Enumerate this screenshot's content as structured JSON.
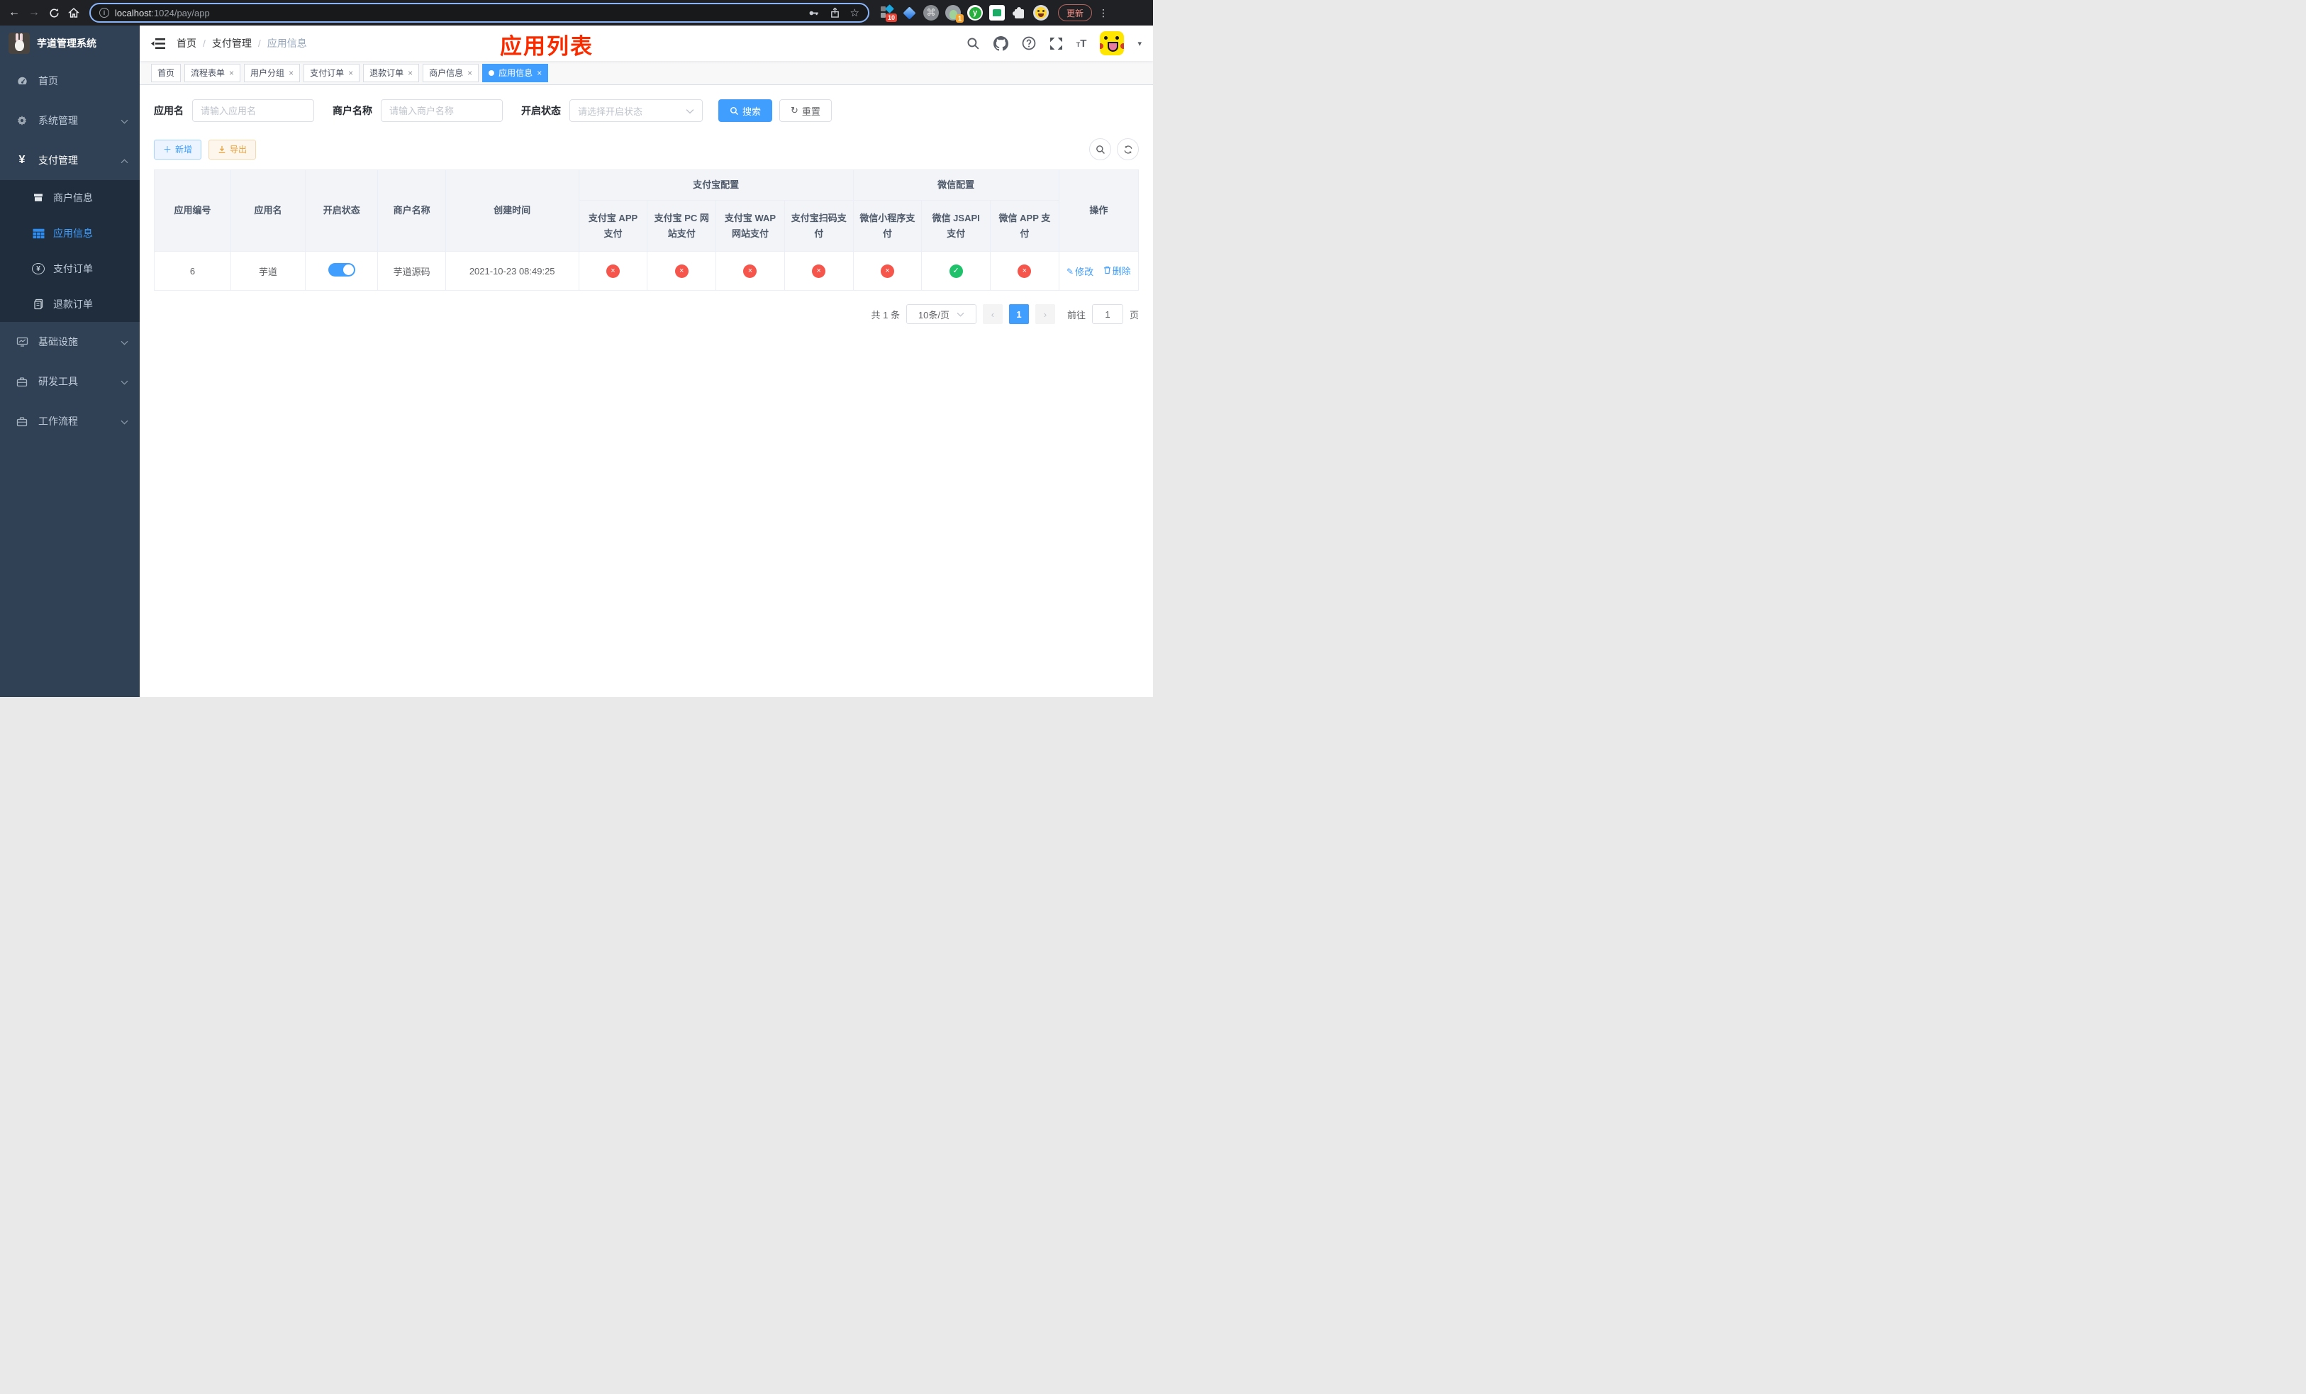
{
  "browser": {
    "url_host": "localhost",
    "url_path": ":1024/pay/app",
    "ext_badge_grid": "10",
    "ext_badge_profile": "1",
    "update_label": "更新"
  },
  "sidebar": {
    "title": "芋道管理系统",
    "menu": [
      {
        "label": "首页"
      },
      {
        "label": "系统管理"
      },
      {
        "label": "支付管理"
      },
      {
        "label": "商户信息"
      },
      {
        "label": "应用信息"
      },
      {
        "label": "支付订单"
      },
      {
        "label": "退款订单"
      },
      {
        "label": "基础设施"
      },
      {
        "label": "研发工具"
      },
      {
        "label": "工作流程"
      }
    ]
  },
  "header": {
    "breadcrumb": [
      "首页",
      "支付管理",
      "应用信息"
    ],
    "overlay_title": "应用列表"
  },
  "tabs": [
    {
      "label": "首页"
    },
    {
      "label": "流程表单"
    },
    {
      "label": "用户分组"
    },
    {
      "label": "支付订单"
    },
    {
      "label": "退款订单"
    },
    {
      "label": "商户信息"
    },
    {
      "label": "应用信息"
    }
  ],
  "filters": {
    "app_name_label": "应用名",
    "app_name_placeholder": "请输入应用名",
    "merchant_label": "商户名称",
    "merchant_placeholder": "请输入商户名称",
    "status_label": "开启状态",
    "status_placeholder": "请选择开启状态",
    "search_label": "搜索",
    "reset_label": "重置"
  },
  "toolbar": {
    "add_label": "新增",
    "export_label": "导出"
  },
  "table": {
    "headers": {
      "app_id": "应用编号",
      "app_name": "应用名",
      "status": "开启状态",
      "merchant": "商户名称",
      "created": "创建时间",
      "alipay_group": "支付宝配置",
      "alipay_cols": [
        "支付宝 APP 支付",
        "支付宝 PC 网站支付",
        "支付宝 WAP 网站支付",
        "支付宝扫码支付"
      ],
      "wechat_group": "微信配置",
      "wechat_cols": [
        "微信小程序支付",
        "微信 JSAPI 支付",
        "微信 APP 支付"
      ],
      "actions": "操作"
    },
    "row": {
      "app_id": "6",
      "app_name": "芋道",
      "enabled": true,
      "merchant": "芋道源码",
      "created": "2021-10-23 08:49:25",
      "channels": [
        false,
        false,
        false,
        false,
        false,
        true,
        false
      ],
      "edit_label": "修改",
      "delete_label": "删除"
    }
  },
  "pagination": {
    "total": "共 1 条",
    "page_size": "10条/页",
    "current_page": "1",
    "goto_label": "前往",
    "goto_value": "1",
    "goto_unit": "页"
  }
}
